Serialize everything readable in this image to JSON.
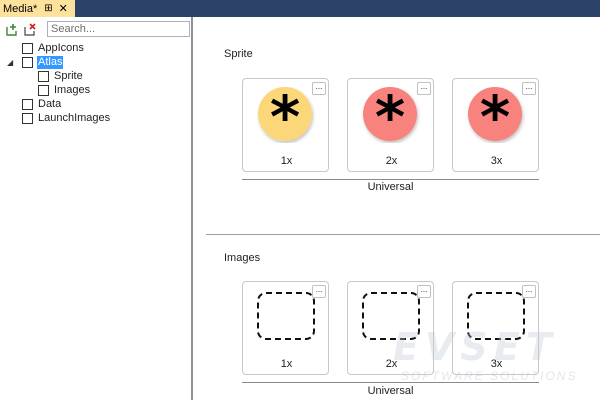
{
  "tab": {
    "title": "Media*",
    "pin_icon": "pin-icon",
    "close_icon": "close-icon"
  },
  "toolbar": {
    "add_icon": "add-folder-icon",
    "remove_icon": "remove-folder-icon"
  },
  "search": {
    "placeholder": "Search..."
  },
  "tree": {
    "items": [
      {
        "label": "AppIcons"
      },
      {
        "label": "Atlas",
        "selected": true,
        "expanded": true
      },
      {
        "label": "Sprite"
      },
      {
        "label": "Images"
      },
      {
        "label": "Data"
      },
      {
        "label": "LaunchImages"
      }
    ]
  },
  "sections": [
    {
      "title": "Sprite",
      "group_label": "Universal",
      "slots": [
        {
          "scale": "1x",
          "art": "asterisk",
          "color": "#fcd77a"
        },
        {
          "scale": "2x",
          "art": "asterisk",
          "color": "#f8827d"
        },
        {
          "scale": "3x",
          "art": "asterisk",
          "color": "#f8827d"
        }
      ]
    },
    {
      "title": "Images",
      "group_label": "Universal",
      "slots": [
        {
          "scale": "1x",
          "art": "empty-placeholder"
        },
        {
          "scale": "2x",
          "art": "empty-placeholder"
        },
        {
          "scale": "3x",
          "art": "empty-placeholder"
        }
      ]
    }
  ],
  "slot_menu": "...",
  "watermark": {
    "main": "EVSET",
    "sub": "SOFTWARE SOLUTIONS"
  }
}
